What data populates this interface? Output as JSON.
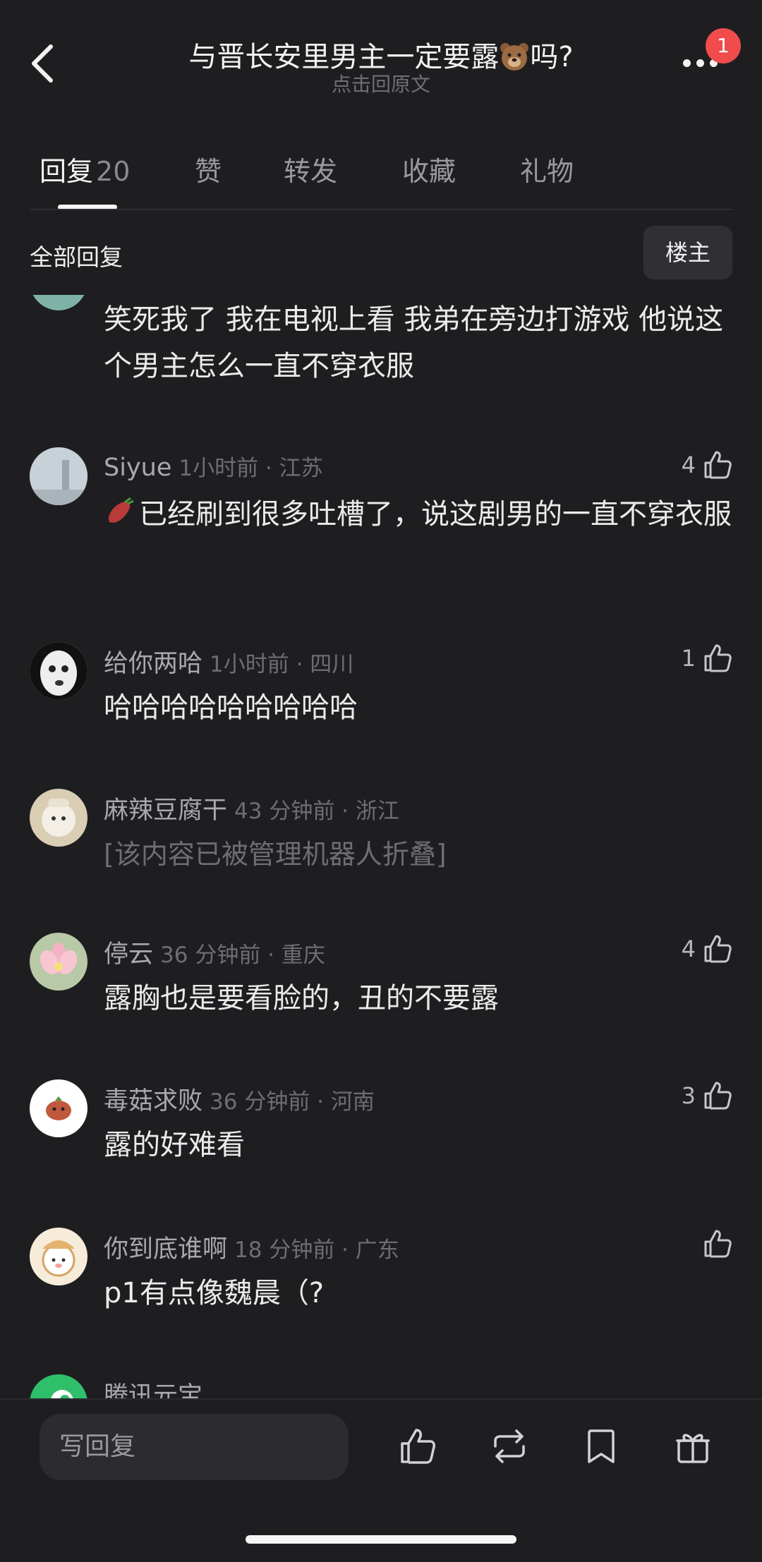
{
  "header": {
    "title_prefix": "与晋长安里男主一定要露",
    "title_suffix": "吗?",
    "subtitle": "点击回原文",
    "notification_count": "1"
  },
  "tabs": [
    {
      "label": "回复",
      "count": "20",
      "active": true
    },
    {
      "label": "赞"
    },
    {
      "label": "转发"
    },
    {
      "label": "收藏"
    },
    {
      "label": "礼物"
    }
  ],
  "filter": {
    "all_replies": "全部回复",
    "op_button": "楼主"
  },
  "comments": [
    {
      "name": "",
      "meta": "",
      "text": "笑死我了 我在电视上看 我弟在旁边打游戏 他说这个男主怎么一直不穿衣服",
      "likes": ""
    },
    {
      "name": "Siyue",
      "meta": "1小时前 · 江苏",
      "text": "已经刷到很多吐槽了，说这剧男的一直不穿衣服",
      "likes": "4"
    },
    {
      "name": "给你两哈",
      "meta": "1小时前 · 四川",
      "text": "哈哈哈哈哈哈哈哈哈",
      "likes": "1"
    },
    {
      "name": "麻辣豆腐干",
      "meta": "43 分钟前 · 浙江",
      "text": "[该内容已被管理机器人折叠]",
      "likes": ""
    },
    {
      "name": "停云",
      "meta": "36 分钟前 · 重庆",
      "text": "露胸也是要看脸的，丑的不要露",
      "likes": "4"
    },
    {
      "name": "毒菇求败",
      "meta": "36 分钟前 · 河南",
      "text": "露的好难看",
      "likes": "3"
    },
    {
      "name": "你到底谁啊",
      "meta": "18 分钟前 · 广东",
      "text": "p1有点像魏晨（?",
      "likes": ""
    },
    {
      "name": "腾讯元宝",
      "meta": "",
      "text": "",
      "likes": ""
    }
  ],
  "bottom_bar": {
    "reply_placeholder": "写回复",
    "icons": [
      "like-icon",
      "repost-icon",
      "bookmark-icon",
      "gift-icon"
    ]
  }
}
